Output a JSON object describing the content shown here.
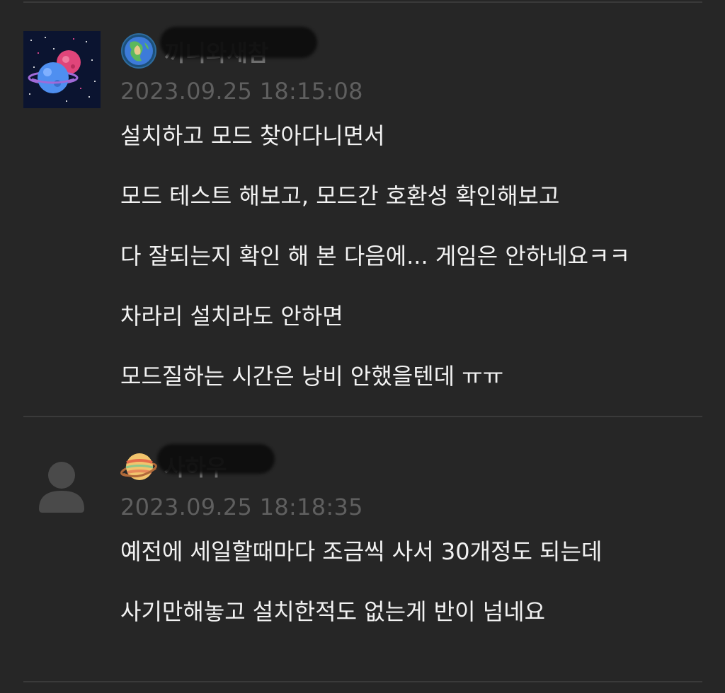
{
  "comments": [
    {
      "nickname": "끼니와새참",
      "timestamp": "2023.09.25 18:15:08",
      "lines": [
        "설치하고 모드 찾아다니면서",
        "모드 테스트 해보고, 모드간 호환성 확인해보고",
        "다 잘되는지 확인 해 본 다음에... 게임은 안하네요ㅋㅋ",
        "차라리 설치라도 안하면",
        "모드질하는 시간은 낭비 안했을텐데 ㅠㅠ"
      ]
    },
    {
      "nickname": "사하우",
      "timestamp": "2023.09.25 18:18:35",
      "lines": [
        "예전에 세일할때마다 조금씩 사서 30개정도 되는데",
        "사기만해놓고 설치한적도 없는게 반이 넘네요"
      ]
    }
  ],
  "icons": {
    "comment1_avatar": "planets-avatar",
    "comment1_badge": "earth-badge-icon",
    "comment2_avatar": "default-user-icon",
    "comment2_badge": "saturn-badge-icon"
  },
  "colors": {
    "background": "#262626",
    "divider": "#3a3a3a",
    "body_text": "#f2f2f2",
    "meta_text": "#5f5f5f"
  }
}
